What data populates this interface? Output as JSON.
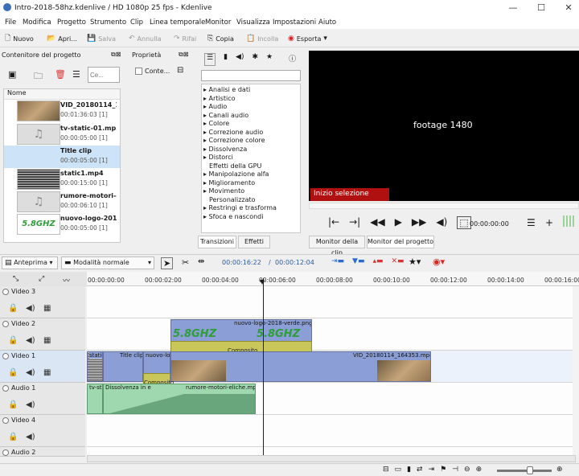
{
  "window": {
    "title": "Intro-2018-58hz.kdenlive / HD 1080p 25 fps - Kdenlive",
    "minimize": "—",
    "maximize": "☐",
    "close": "✕"
  },
  "menu": [
    "File",
    "Modifica",
    "Progetto",
    "Strumento",
    "Clip",
    "Linea temporale",
    "Monitor",
    "Visualizza",
    "Impostazioni",
    "Aiuto"
  ],
  "toolbar": {
    "new": "Nuovo",
    "open": "Apri...",
    "save": "Salva",
    "undo": "Annulla",
    "redo": "Rifai",
    "copy": "Copia",
    "paste": "Incolla",
    "render": "Esporta"
  },
  "project_bin": {
    "title": "Contenitore del progetto",
    "search_placeholder": "Ce...",
    "column": "Nome",
    "items": [
      {
        "name": "VID_20180114_1...",
        "dur": "00:01:36:03  [1]"
      },
      {
        "name": "tv-static-01.mp3",
        "dur": "00:00:05:00  [1]"
      },
      {
        "name": "Title clip",
        "dur": "00:00:05:00  [1]"
      },
      {
        "name": "static1.mp4",
        "dur": "00:00:15:00  [1]"
      },
      {
        "name": "rumore-motori-eliche...",
        "dur": "00:00:06:10  [1]"
      },
      {
        "name": "nuovo-logo-2018...",
        "dur": "00:00:05:00  [1]"
      }
    ]
  },
  "properties": {
    "title": "Proprietà",
    "checkbox": "Conte..."
  },
  "effects": {
    "items": [
      "Analisi e dati",
      "Artistico",
      "Audio",
      "Canali audio",
      "Colore",
      "Correzione audio",
      "Correzione colore",
      "Dissolvenza",
      "Distorci",
      "Effetti della GPU",
      "Manipolazione alfa",
      "Miglioramento",
      "Movimento",
      "Personalizzato",
      "Restringi e trasforma",
      "Sfoca e nascondi"
    ],
    "tabs": {
      "transitions": "Transizioni",
      "effects": "Effetti"
    }
  },
  "monitor": {
    "overlay": "footage 1480",
    "zone_label": "Inizio selezione",
    "timecode": "00:00:00:00",
    "tab_clip": "Monitor della clip",
    "tab_project": "Monitor del progetto"
  },
  "timeline_toolbar": {
    "preview": "Anteprima",
    "mode": "Modalità normale",
    "position": "00:00:16:22",
    "duration": "00:00:12:04"
  },
  "ruler": [
    "00:00:00:00",
    "00:00:02:00",
    "00:00:04:00",
    "00:00:06:00",
    "00:00:08:00",
    "00:00:10:00",
    "00:00:12:00",
    "00:00:14:00",
    "00:00:16:00"
  ],
  "tracks": [
    {
      "name": "Video 3"
    },
    {
      "name": "Video 2"
    },
    {
      "name": "Video 1"
    },
    {
      "name": "Audio 1"
    },
    {
      "name": "Video 4"
    },
    {
      "name": "Audio 2"
    }
  ],
  "clips": {
    "logo": "nuovo-logo-2018-verde.png",
    "comp1": "Composito",
    "static": "static",
    "title": "Title clip",
    "nuovo": "nuovo-logo",
    "vid": "VID_20180114_164353.mp4",
    "comp2": "Composito",
    "tvsta": "tv-sta",
    "diss": "Dissolvenza in e",
    "rumore": "rumore-motori-eliche.mp3"
  },
  "logo_text": "5.8GHZ"
}
